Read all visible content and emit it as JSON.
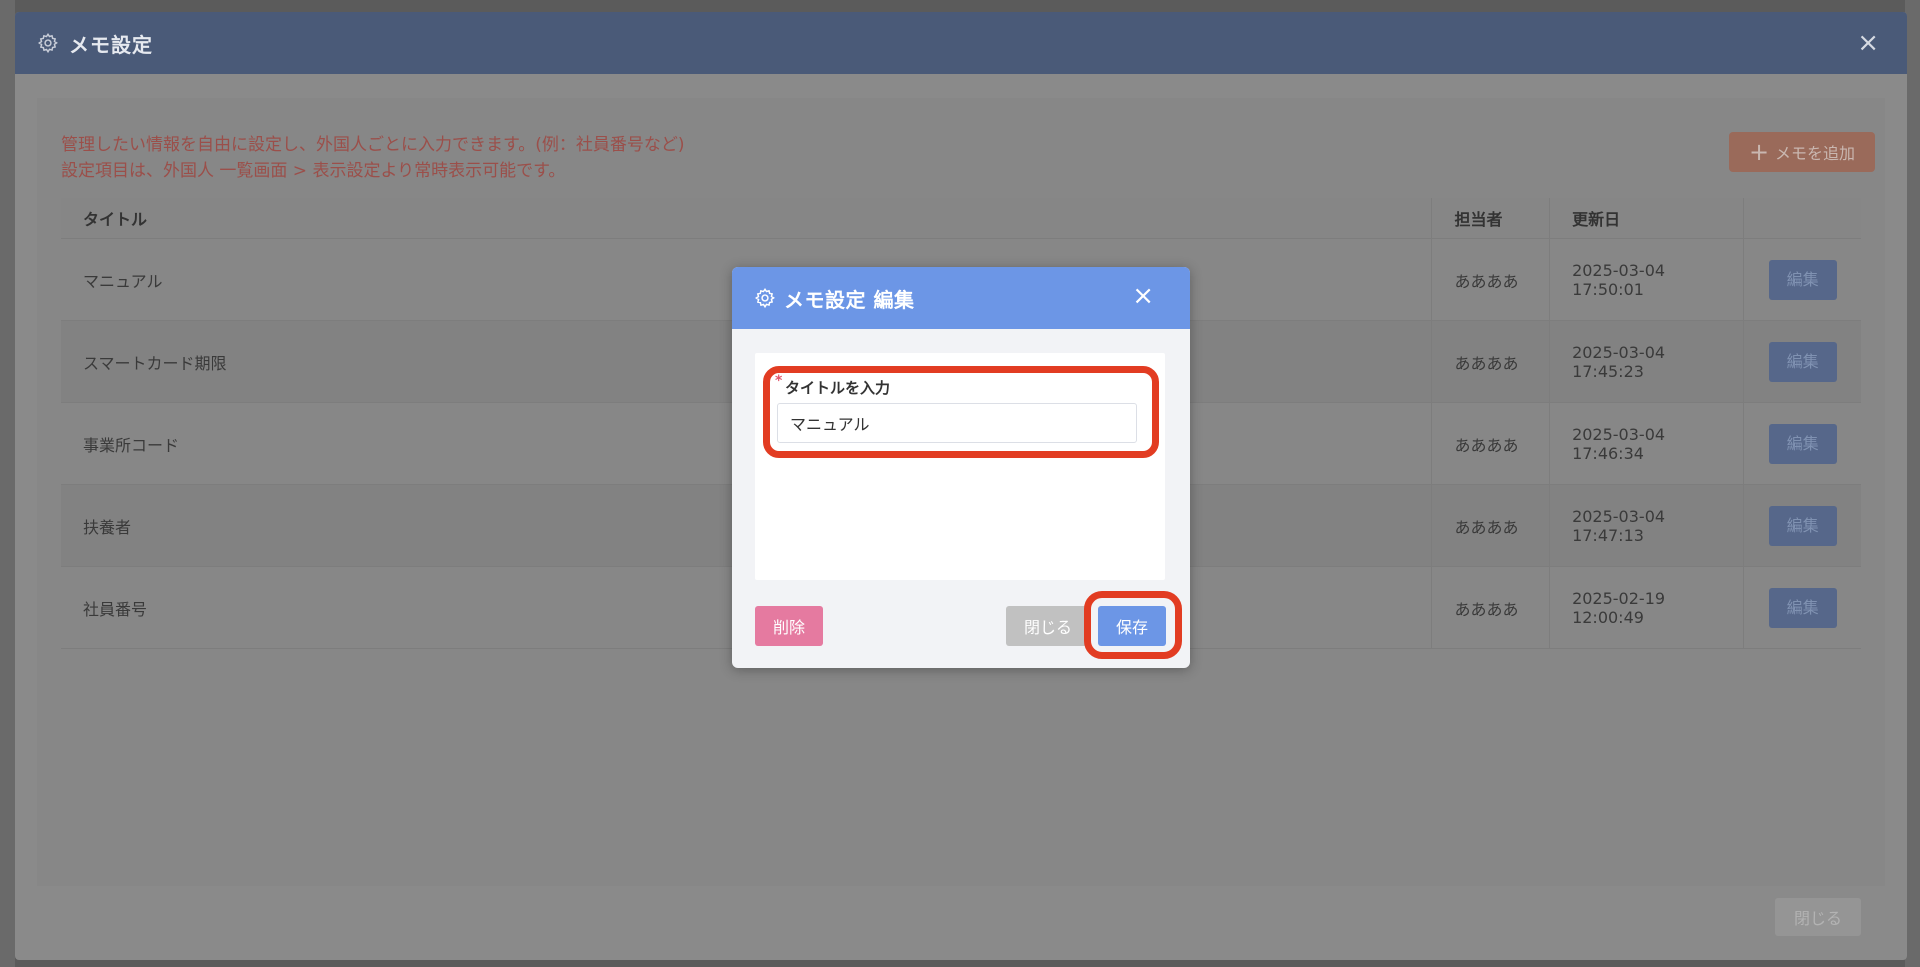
{
  "outer": {
    "title": "メモ設定",
    "close_icon": "×",
    "notice_line1": "管理したい情報を自由に設定し、外国人ごとに入力できます。(例：社員番号など)",
    "notice_line2": "設定項目は、外国人 一覧画面 > 表示設定より常時表示可能です。",
    "add_button": "メモを追加",
    "close_button": "閉じる",
    "table": {
      "headers": [
        "タイトル",
        "担当者",
        "更新日",
        ""
      ],
      "rows": [
        {
          "title": "マニュアル",
          "owner": "ああああ",
          "date": "2025-03-04 17:50:01",
          "action": "編集"
        },
        {
          "title": "スマートカード期限",
          "owner": "ああああ",
          "date": "2025-03-04 17:45:23",
          "action": "編集"
        },
        {
          "title": "事業所コード",
          "owner": "ああああ",
          "date": "2025-03-04 17:46:34",
          "action": "編集"
        },
        {
          "title": "扶養者",
          "owner": "ああああ",
          "date": "2025-03-04 17:47:13",
          "action": "編集"
        },
        {
          "title": "社員番号",
          "owner": "ああああ",
          "date": "2025-02-19 12:00:49",
          "action": "編集"
        }
      ]
    }
  },
  "inner": {
    "title": "メモ設定 編集",
    "close_icon": "×",
    "required_mark": "*",
    "field_label": "タイトルを入力",
    "field_value": "マニュアル",
    "delete_button": "削除",
    "close_button": "閉じる",
    "save_button": "保存"
  },
  "colors": {
    "accent": "#6c96e6",
    "highlight": "#e23c22",
    "danger": "#e57aa0"
  },
  "icons": {
    "header_icon": "gear-icon",
    "close": "close-icon",
    "add": "plus-icon"
  }
}
